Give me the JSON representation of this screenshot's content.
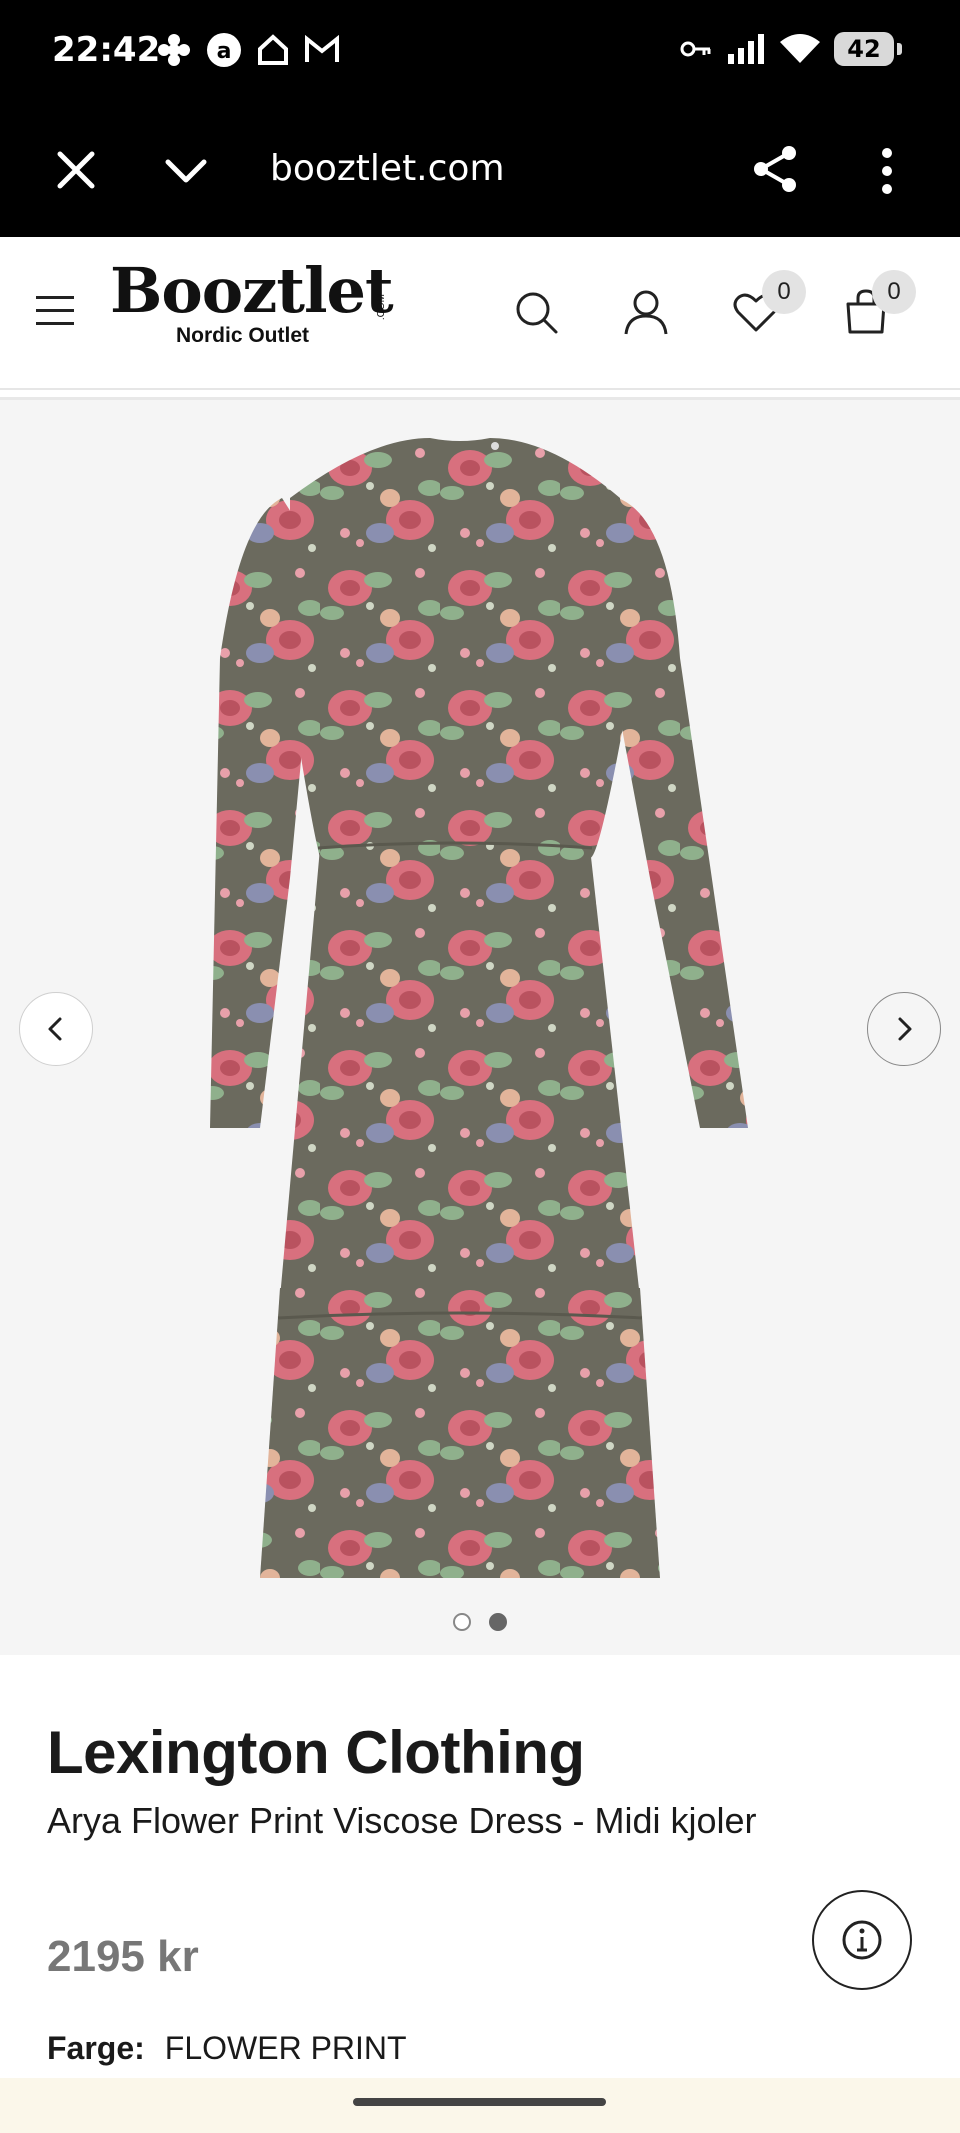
{
  "status_bar": {
    "time": "22:42",
    "battery": "42",
    "left_icons": [
      "flower-notification-icon",
      "app-notification-icon",
      "home-notification-icon",
      "gmail-icon"
    ],
    "right_icons": [
      "key-icon",
      "signal-icon",
      "wifi-icon",
      "battery-icon"
    ]
  },
  "browser": {
    "url": "booztlet.com",
    "icons": [
      "close-icon",
      "chevron-down-icon",
      "share-icon",
      "more-vert-icon"
    ]
  },
  "header": {
    "logo_text": "Booztlet",
    "logo_com": ".COM",
    "logo_tagline": "Nordic Outlet",
    "wishlist_count": "0",
    "cart_count": "0",
    "icons": [
      "menu-icon",
      "search-icon",
      "account-icon",
      "heart-icon",
      "bag-icon"
    ]
  },
  "gallery": {
    "current_image": 2,
    "total_images": 2,
    "icons": [
      "chevron-left-icon",
      "chevron-right-icon"
    ]
  },
  "product": {
    "brand": "Lexington Clothing",
    "name": "Arya Flower Print Viscose Dress - Midi kjoler",
    "price": "2195 kr",
    "color_label": "Farge:",
    "color_value": "FLOWER PRINT"
  },
  "colors": {
    "dress_base": "#6b6a5e",
    "floral_pink": "#d8707e",
    "floral_green": "#8fb08c",
    "price_grey": "#777777"
  }
}
